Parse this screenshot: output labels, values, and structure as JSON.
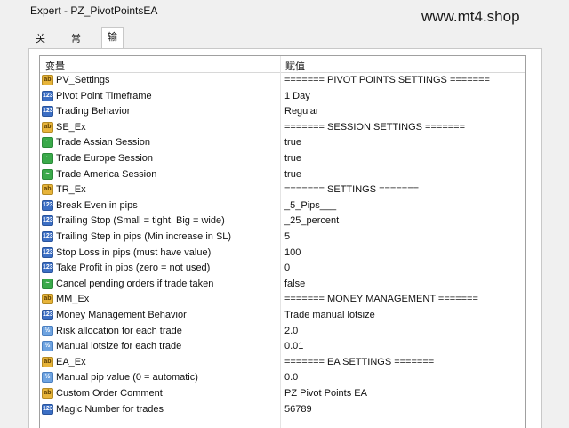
{
  "window": {
    "title": "Expert - PZ_PivotPointsEA",
    "watermark": "www.mt4.shop"
  },
  "tabs": [
    "关于",
    "常用",
    "输入参数"
  ],
  "table": {
    "headers": [
      "变量",
      "赋值"
    ],
    "rows": [
      {
        "type": "ab",
        "name": "PV_Settings",
        "value": "======= PIVOT POINTS SETTINGS ======="
      },
      {
        "type": "num",
        "name": "Pivot Point Timeframe",
        "value": "1 Day"
      },
      {
        "type": "num",
        "name": "Trading Behavior",
        "value": "Regular"
      },
      {
        "type": "ab",
        "name": "SE_Ex",
        "value": "======= SESSION SETTINGS ======="
      },
      {
        "type": "bool",
        "name": "Trade Assian Session",
        "value": "true"
      },
      {
        "type": "bool",
        "name": "Trade Europe Session",
        "value": "true"
      },
      {
        "type": "bool",
        "name": "Trade America Session",
        "value": "true"
      },
      {
        "type": "ab",
        "name": "TR_Ex",
        "value": "======= SETTINGS ======="
      },
      {
        "type": "num",
        "name": "Break Even in pips",
        "value": "_5_Pips___"
      },
      {
        "type": "num",
        "name": "Trailing Stop (Small = tight, Big = wide)",
        "value": "_25_percent"
      },
      {
        "type": "num",
        "name": "Trailing Step in pips (Min increase in SL)",
        "value": "5"
      },
      {
        "type": "num",
        "name": "Stop Loss in pips (must have value)",
        "value": "100"
      },
      {
        "type": "num",
        "name": "Take Profit in pips (zero = not used)",
        "value": "0"
      },
      {
        "type": "bool",
        "name": "Cancel pending orders if trade taken",
        "value": "false"
      },
      {
        "type": "ab",
        "name": "MM_Ex",
        "value": "======= MONEY MANAGEMENT ======="
      },
      {
        "type": "num",
        "name": "Money Management Behavior",
        "value": "Trade manual lotsize"
      },
      {
        "type": "dbl",
        "name": "Risk allocation for each trade",
        "value": "2.0"
      },
      {
        "type": "dbl",
        "name": "Manual lotsize for each trade",
        "value": "0.01"
      },
      {
        "type": "ab",
        "name": "EA_Ex",
        "value": "======= EA SETTINGS ======="
      },
      {
        "type": "dbl",
        "name": "Manual pip value (0 = automatic)",
        "value": "0.0"
      },
      {
        "type": "ab",
        "name": "Custom Order Comment",
        "value": "PZ Pivot Points EA"
      },
      {
        "type": "num",
        "name": "Magic Number for trades",
        "value": "56789"
      }
    ]
  },
  "icon_glyphs": {
    "ab": "ab",
    "num": "123",
    "dbl": "½",
    "bool": "~"
  }
}
